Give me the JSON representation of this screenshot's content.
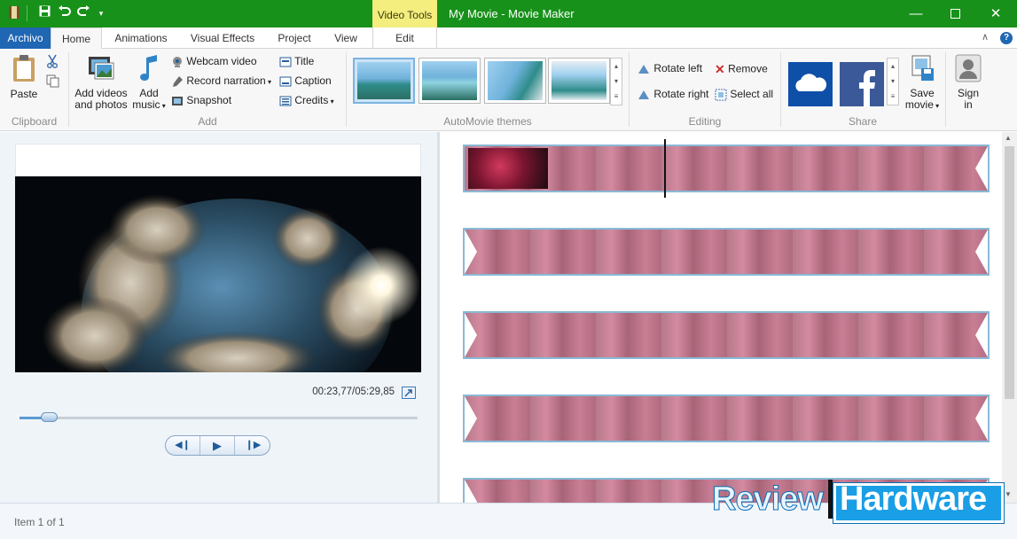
{
  "window": {
    "title": "My Movie - Movie Maker",
    "context_tab": "Video Tools",
    "title_bar_color": "#17911a",
    "controls": [
      "minimize-icon",
      "maximize-icon",
      "close-icon"
    ]
  },
  "tabs": [
    {
      "label": "Archivo",
      "active": false
    },
    {
      "label": "Home",
      "active": true
    },
    {
      "label": "Animations",
      "active": false
    },
    {
      "label": "Visual Effects",
      "active": false
    },
    {
      "label": "Project",
      "active": false
    },
    {
      "label": "View",
      "active": false
    },
    {
      "label": "Edit",
      "active": false
    }
  ],
  "ribbon": {
    "clipboard": {
      "paste": "Paste",
      "group": "Clipboard"
    },
    "add": {
      "add_videos_line1": "Add videos",
      "add_videos_line2": "and photos",
      "add_music_line1": "Add",
      "add_music_line2": "music",
      "webcam": "Webcam video",
      "narration": "Record narration",
      "snapshot": "Snapshot",
      "title": "Title",
      "caption": "Caption",
      "credits": "Credits",
      "group": "Add"
    },
    "themes": {
      "group": "AutoMovie themes"
    },
    "editing": {
      "rotate_left": "Rotate left",
      "rotate_right": "Rotate right",
      "remove": "Remove",
      "select_all": "Select all",
      "group": "Editing"
    },
    "share": {
      "save_line1": "Save",
      "save_line2": "movie",
      "group": "Share"
    },
    "signin": {
      "line1": "Sign",
      "line2": "in"
    }
  },
  "preview": {
    "timecode": "00:23,77/05:29,85",
    "progress_fraction": 0.072
  },
  "status": {
    "item": "Item 1 of 1"
  },
  "watermark": {
    "part1": "Review",
    "part2": "Hardware"
  }
}
